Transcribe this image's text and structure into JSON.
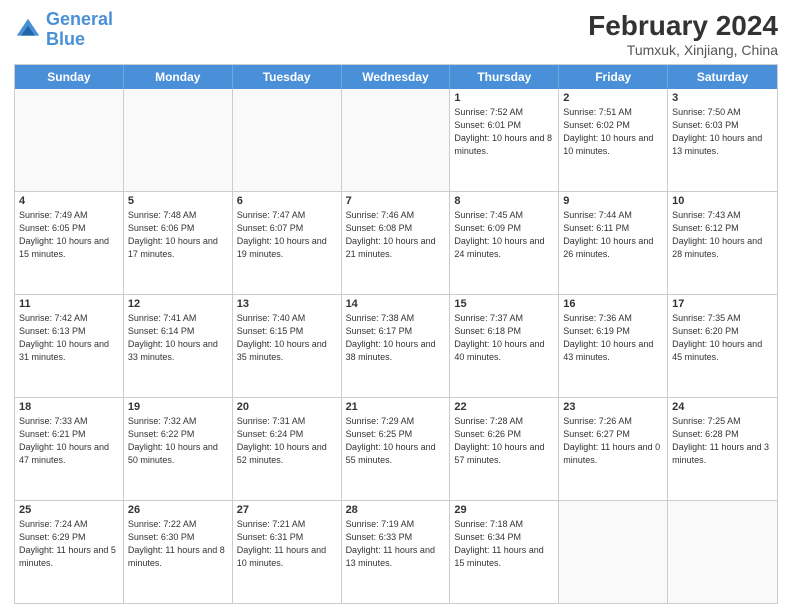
{
  "header": {
    "logo_line1": "General",
    "logo_line2": "Blue",
    "main_title": "February 2024",
    "subtitle": "Tumxuk, Xinjiang, China"
  },
  "weekdays": [
    "Sunday",
    "Monday",
    "Tuesday",
    "Wednesday",
    "Thursday",
    "Friday",
    "Saturday"
  ],
  "rows": [
    [
      {
        "day": "",
        "info": "",
        "empty": true
      },
      {
        "day": "",
        "info": "",
        "empty": true
      },
      {
        "day": "",
        "info": "",
        "empty": true
      },
      {
        "day": "",
        "info": "",
        "empty": true
      },
      {
        "day": "1",
        "info": "Sunrise: 7:52 AM\nSunset: 6:01 PM\nDaylight: 10 hours\nand 8 minutes.",
        "empty": false
      },
      {
        "day": "2",
        "info": "Sunrise: 7:51 AM\nSunset: 6:02 PM\nDaylight: 10 hours\nand 10 minutes.",
        "empty": false
      },
      {
        "day": "3",
        "info": "Sunrise: 7:50 AM\nSunset: 6:03 PM\nDaylight: 10 hours\nand 13 minutes.",
        "empty": false
      }
    ],
    [
      {
        "day": "4",
        "info": "Sunrise: 7:49 AM\nSunset: 6:05 PM\nDaylight: 10 hours\nand 15 minutes.",
        "empty": false
      },
      {
        "day": "5",
        "info": "Sunrise: 7:48 AM\nSunset: 6:06 PM\nDaylight: 10 hours\nand 17 minutes.",
        "empty": false
      },
      {
        "day": "6",
        "info": "Sunrise: 7:47 AM\nSunset: 6:07 PM\nDaylight: 10 hours\nand 19 minutes.",
        "empty": false
      },
      {
        "day": "7",
        "info": "Sunrise: 7:46 AM\nSunset: 6:08 PM\nDaylight: 10 hours\nand 21 minutes.",
        "empty": false
      },
      {
        "day": "8",
        "info": "Sunrise: 7:45 AM\nSunset: 6:09 PM\nDaylight: 10 hours\nand 24 minutes.",
        "empty": false
      },
      {
        "day": "9",
        "info": "Sunrise: 7:44 AM\nSunset: 6:11 PM\nDaylight: 10 hours\nand 26 minutes.",
        "empty": false
      },
      {
        "day": "10",
        "info": "Sunrise: 7:43 AM\nSunset: 6:12 PM\nDaylight: 10 hours\nand 28 minutes.",
        "empty": false
      }
    ],
    [
      {
        "day": "11",
        "info": "Sunrise: 7:42 AM\nSunset: 6:13 PM\nDaylight: 10 hours\nand 31 minutes.",
        "empty": false
      },
      {
        "day": "12",
        "info": "Sunrise: 7:41 AM\nSunset: 6:14 PM\nDaylight: 10 hours\nand 33 minutes.",
        "empty": false
      },
      {
        "day": "13",
        "info": "Sunrise: 7:40 AM\nSunset: 6:15 PM\nDaylight: 10 hours\nand 35 minutes.",
        "empty": false
      },
      {
        "day": "14",
        "info": "Sunrise: 7:38 AM\nSunset: 6:17 PM\nDaylight: 10 hours\nand 38 minutes.",
        "empty": false
      },
      {
        "day": "15",
        "info": "Sunrise: 7:37 AM\nSunset: 6:18 PM\nDaylight: 10 hours\nand 40 minutes.",
        "empty": false
      },
      {
        "day": "16",
        "info": "Sunrise: 7:36 AM\nSunset: 6:19 PM\nDaylight: 10 hours\nand 43 minutes.",
        "empty": false
      },
      {
        "day": "17",
        "info": "Sunrise: 7:35 AM\nSunset: 6:20 PM\nDaylight: 10 hours\nand 45 minutes.",
        "empty": false
      }
    ],
    [
      {
        "day": "18",
        "info": "Sunrise: 7:33 AM\nSunset: 6:21 PM\nDaylight: 10 hours\nand 47 minutes.",
        "empty": false
      },
      {
        "day": "19",
        "info": "Sunrise: 7:32 AM\nSunset: 6:22 PM\nDaylight: 10 hours\nand 50 minutes.",
        "empty": false
      },
      {
        "day": "20",
        "info": "Sunrise: 7:31 AM\nSunset: 6:24 PM\nDaylight: 10 hours\nand 52 minutes.",
        "empty": false
      },
      {
        "day": "21",
        "info": "Sunrise: 7:29 AM\nSunset: 6:25 PM\nDaylight: 10 hours\nand 55 minutes.",
        "empty": false
      },
      {
        "day": "22",
        "info": "Sunrise: 7:28 AM\nSunset: 6:26 PM\nDaylight: 10 hours\nand 57 minutes.",
        "empty": false
      },
      {
        "day": "23",
        "info": "Sunrise: 7:26 AM\nSunset: 6:27 PM\nDaylight: 11 hours\nand 0 minutes.",
        "empty": false
      },
      {
        "day": "24",
        "info": "Sunrise: 7:25 AM\nSunset: 6:28 PM\nDaylight: 11 hours\nand 3 minutes.",
        "empty": false
      }
    ],
    [
      {
        "day": "25",
        "info": "Sunrise: 7:24 AM\nSunset: 6:29 PM\nDaylight: 11 hours\nand 5 minutes.",
        "empty": false
      },
      {
        "day": "26",
        "info": "Sunrise: 7:22 AM\nSunset: 6:30 PM\nDaylight: 11 hours\nand 8 minutes.",
        "empty": false
      },
      {
        "day": "27",
        "info": "Sunrise: 7:21 AM\nSunset: 6:31 PM\nDaylight: 11 hours\nand 10 minutes.",
        "empty": false
      },
      {
        "day": "28",
        "info": "Sunrise: 7:19 AM\nSunset: 6:33 PM\nDaylight: 11 hours\nand 13 minutes.",
        "empty": false
      },
      {
        "day": "29",
        "info": "Sunrise: 7:18 AM\nSunset: 6:34 PM\nDaylight: 11 hours\nand 15 minutes.",
        "empty": false
      },
      {
        "day": "",
        "info": "",
        "empty": true
      },
      {
        "day": "",
        "info": "",
        "empty": true
      }
    ]
  ]
}
